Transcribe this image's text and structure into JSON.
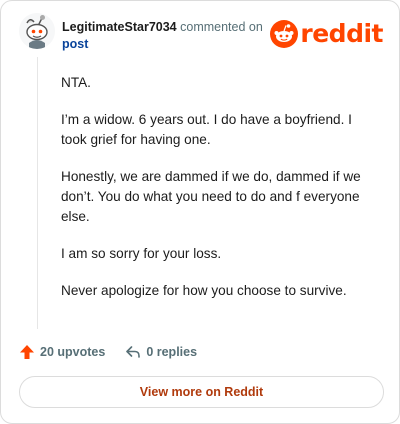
{
  "comment": {
    "author": "LegitimateStar7034",
    "action": "commented on",
    "target": "post",
    "paragraphs": [
      "NTA.",
      "I’m a widow. 6 years out. I do have a boyfriend. I took grief for having one.",
      "Honestly, we are dammed if we do, dammed if we don’t. You do what you need to do and f everyone else.",
      "I am so sorry for your loss.",
      "Never apologize for how you choose to survive."
    ]
  },
  "brand": {
    "wordmark": "reddit",
    "color": "#ff4500",
    "icon": "reddit-snoo-icon"
  },
  "actions": {
    "upvotes": "20 upvotes",
    "replies": "0 replies",
    "upvote_color": "#ff4500"
  },
  "footer": {
    "view_more": "View more on Reddit"
  }
}
